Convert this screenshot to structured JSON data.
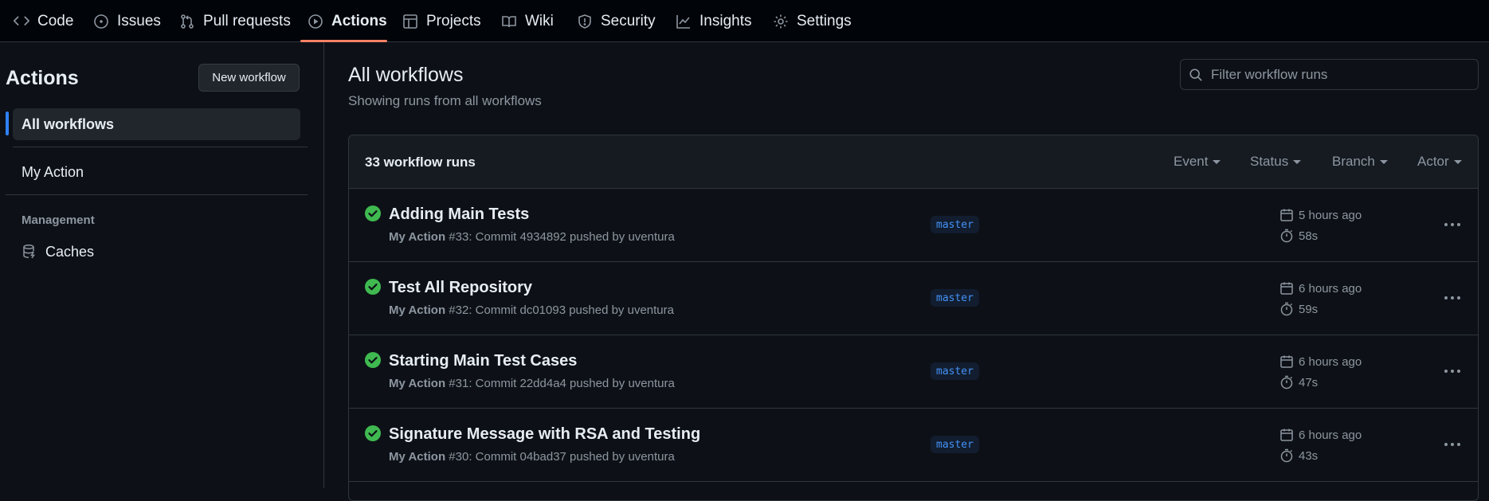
{
  "tabs": [
    {
      "label": "Code",
      "icon": "code-icon"
    },
    {
      "label": "Issues",
      "icon": "issue-icon"
    },
    {
      "label": "Pull requests",
      "icon": "pull-request-icon"
    },
    {
      "label": "Actions",
      "icon": "play-icon",
      "active": true
    },
    {
      "label": "Projects",
      "icon": "table-icon"
    },
    {
      "label": "Wiki",
      "icon": "book-icon"
    },
    {
      "label": "Security",
      "icon": "shield-icon"
    },
    {
      "label": "Insights",
      "icon": "graph-icon"
    },
    {
      "label": "Settings",
      "icon": "gear-icon"
    }
  ],
  "sidebar": {
    "title": "Actions",
    "new_workflow_label": "New workflow",
    "items": [
      {
        "label": "All workflows",
        "selected": true
      },
      {
        "label": "My Action"
      }
    ],
    "management_label": "Management",
    "caches_label": "Caches"
  },
  "main": {
    "title": "All workflows",
    "subtitle": "Showing runs from all workflows",
    "filter_placeholder": "Filter workflow runs",
    "runs_count": "33 workflow runs",
    "filters": {
      "event": "Event",
      "status": "Status",
      "branch": "Branch",
      "actor": "Actor"
    },
    "runs": [
      {
        "title": "Adding Main Tests",
        "workflow": "My Action",
        "meta": "#33: Commit 4934892 pushed by uventura",
        "branch": "master",
        "when": "5 hours ago",
        "duration": "58s"
      },
      {
        "title": "Test All Repository",
        "workflow": "My Action",
        "meta": "#32: Commit dc01093 pushed by uventura",
        "branch": "master",
        "when": "6 hours ago",
        "duration": "59s"
      },
      {
        "title": "Starting Main Test Cases",
        "workflow": "My Action",
        "meta": "#31: Commit 22dd4a4 pushed by uventura",
        "branch": "master",
        "when": "6 hours ago",
        "duration": "47s"
      },
      {
        "title": "Signature Message with RSA and Testing",
        "workflow": "My Action",
        "meta": "#30: Commit 04bad37 pushed by uventura",
        "branch": "master",
        "when": "6 hours ago",
        "duration": "43s"
      }
    ]
  },
  "colors": {
    "background": "#0d1117",
    "accent_underline": "#f78166",
    "selected_bar": "#2f81f7",
    "success": "#3fb950",
    "branch_text": "#4493f8"
  }
}
